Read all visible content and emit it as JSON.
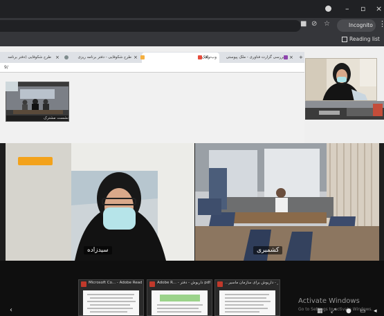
{
  "browser": {
    "window_controls": [
      "–",
      "▫",
      "×"
    ],
    "incognito_label": "Incognito",
    "reading_list_label": "Reading list",
    "tab_close": "×",
    "new_tab": "+"
  },
  "shared_screen": {
    "address_text": "9/",
    "tabs": [
      {
        "label": "بررسی گزارت فناوری - ملک پیوستی"
      },
      {
        "label": "وب‌نوکتک"
      },
      {
        "label": "طرح شکوفایی - دفتر برنامه ریزی"
      },
      {
        "label": "طرح شکوفایی (دفتر برنامه"
      }
    ],
    "thumb_label": "نشست مشترک"
  },
  "participants": {
    "left_name": "سیدزاده",
    "right_name": "کشمیری"
  },
  "taskbar": {
    "thumbnails": [
      {
        "title": "Microsoft Co... - Adobe Reader"
      },
      {
        "title": "Adobe R... - داریوش - دفتر pdf .کارپرداز"
      },
      {
        "title": "...کارپرداز - داریوش برای سازمان ماسیر"
      }
    ]
  },
  "watermark": {
    "title": "Activate Windows",
    "subtitle": "Go to Settings to activate Windows."
  },
  "colors": {
    "titlebar": "#202124",
    "toolbar": "#35363a",
    "accent_orange": "#f39c12"
  }
}
